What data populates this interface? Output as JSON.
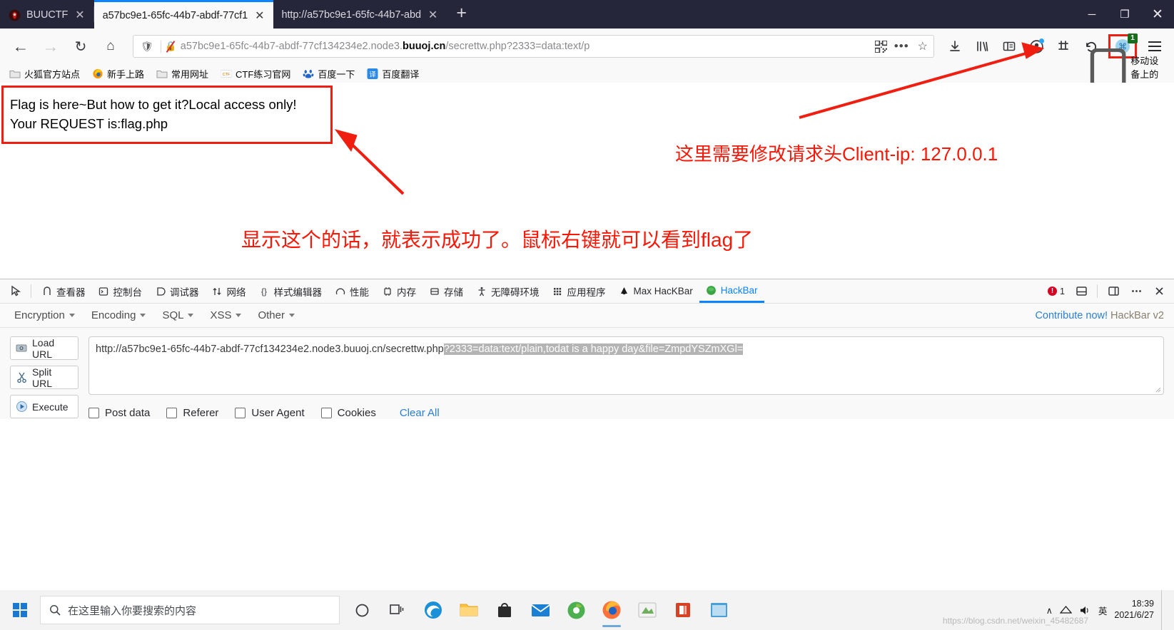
{
  "window": {
    "controls": {
      "minimize": "─",
      "maximize": "❐",
      "close": "✕"
    }
  },
  "tabs": [
    {
      "title": "BUUCTF",
      "favicon": "buuctf-logo-icon",
      "close": "✕",
      "active": false
    },
    {
      "title": "a57bc9e1-65fc-44b7-abdf-77cf1",
      "favicon": "page-icon",
      "close": "✕",
      "active": true
    },
    {
      "title": "http://a57bc9e1-65fc-44b7-abd",
      "favicon": "page-icon",
      "close": "✕",
      "active": false
    }
  ],
  "new_tab_label": "+",
  "navbar": {
    "back_icon": "←",
    "forward_icon": "→",
    "reload_icon": "↻",
    "home_icon": "⌂",
    "url_prefix": "a57bc9e1-65fc-44b7-abdf-77cf134234e2.node3.",
    "url_domain": "buuoj.cn",
    "url_suffix": "/secrettw.php?2333=data:text/p",
    "menu_dots": "•••",
    "star_icon": "☆",
    "extension_badge": "1"
  },
  "bookmarks": {
    "items": [
      {
        "label": "火狐官方站点",
        "icon": "folder-icon"
      },
      {
        "label": "新手上路",
        "icon": "firefox-icon"
      },
      {
        "label": "常用网址",
        "icon": "folder-icon"
      },
      {
        "label": "CTF练习官网",
        "icon": "ctf-icon"
      },
      {
        "label": "百度一下",
        "icon": "baidu-icon"
      },
      {
        "label": "百度翻译",
        "icon": "baidu-translate-icon"
      }
    ],
    "mobile_label": "移动设备上的书签"
  },
  "page": {
    "line1": "Flag is here~But how to get it?Local access only!",
    "line2": "Your REQUEST is:flag.php"
  },
  "annotations": {
    "note_right": "这里需要修改请求头Client-ip: 127.0.0.1",
    "note_bottom": "显示这个的话，就表示成功了。鼠标右键就可以看到flag了",
    "color": "#fb1605"
  },
  "devtools": {
    "tabs": [
      {
        "label": "查看器",
        "icon": "inspector-icon",
        "active": false
      },
      {
        "label": "控制台",
        "icon": "console-icon",
        "active": false
      },
      {
        "label": "调试器",
        "icon": "debugger-icon",
        "active": false
      },
      {
        "label": "网络",
        "icon": "network-icon",
        "active": false
      },
      {
        "label": "样式编辑器",
        "icon": "style-editor-icon",
        "active": false
      },
      {
        "label": "性能",
        "icon": "performance-icon",
        "active": false
      },
      {
        "label": "内存",
        "icon": "memory-icon",
        "active": false
      },
      {
        "label": "存储",
        "icon": "storage-icon",
        "active": false
      },
      {
        "label": "无障碍环境",
        "icon": "accessibility-icon",
        "active": false
      },
      {
        "label": "应用程序",
        "icon": "application-icon",
        "active": false
      },
      {
        "label": "Max HacKBar",
        "icon": "max-hackbar-icon",
        "active": false
      },
      {
        "label": "HackBar",
        "icon": "hackbar-icon",
        "active": true
      }
    ],
    "error_count": "1"
  },
  "hackbar": {
    "menu": [
      {
        "label": "Encryption"
      },
      {
        "label": "Encoding"
      },
      {
        "label": "SQL"
      },
      {
        "label": "XSS"
      },
      {
        "label": "Other"
      }
    ],
    "contribute_link": "Contribute now!",
    "version_text": "HackBar v2",
    "buttons": [
      {
        "label": "Load URL",
        "icon": "load-url-icon"
      },
      {
        "label": "Split URL",
        "icon": "split-url-icon"
      },
      {
        "label": "Execute",
        "icon": "execute-icon"
      }
    ],
    "url_plain": "http://a57bc9e1-65fc-44b7-abdf-77cf134234e2.node3.buuoj.cn/secrettw.php",
    "url_selected": "?2333=data:text/plain,todat is a happy day&file=ZmpdYSZmXGl=",
    "options": [
      {
        "label": "Post data",
        "checked": false
      },
      {
        "label": "Referer",
        "checked": false
      },
      {
        "label": "User Agent",
        "checked": false
      },
      {
        "label": "Cookies",
        "checked": false
      }
    ],
    "clear_all": "Clear All"
  },
  "taskbar": {
    "search_placeholder": "在这里输入你要搜索的内容",
    "apps": [
      {
        "name": "cortana-icon"
      },
      {
        "name": "task-view-icon"
      },
      {
        "name": "edge-icon"
      },
      {
        "name": "file-explorer-icon"
      },
      {
        "name": "store-icon"
      },
      {
        "name": "mail-icon"
      },
      {
        "name": "browser-icon"
      },
      {
        "name": "firefox-icon"
      },
      {
        "name": "tool-icon"
      },
      {
        "name": "pdf-icon"
      },
      {
        "name": "window-icon"
      }
    ],
    "tray_chevron": "∧",
    "tray_network": "network-icon",
    "tray_volume": "volume-icon",
    "ime_label": "英",
    "time": "18:39",
    "date": "2021/6/27"
  },
  "watermark": "https://blog.csdn.net/weixin_45482687"
}
